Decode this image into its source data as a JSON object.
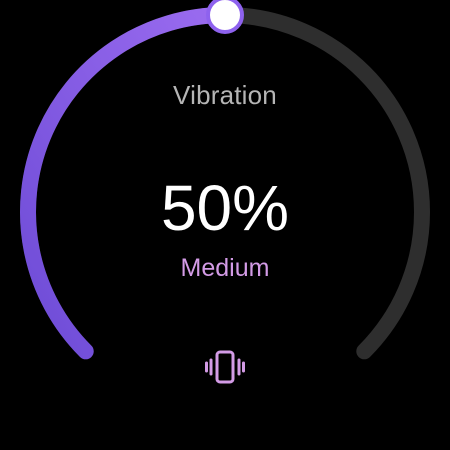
{
  "title": "Vibration",
  "level": {
    "percent_text": "50%",
    "fraction": 0.5,
    "label": "Medium"
  },
  "icons": {
    "vibration": "vibrate-icon",
    "thumb": "slider-thumb"
  },
  "colors": {
    "background": "#000000",
    "arc_track": "#2e2e2e",
    "arc_fill_start": "#6d4bd6",
    "arc_fill_end": "#9b6cf0",
    "thumb": "#ffffff",
    "label": "#d39be6",
    "icon": "#d39be6",
    "title": "#b5b5b5"
  }
}
